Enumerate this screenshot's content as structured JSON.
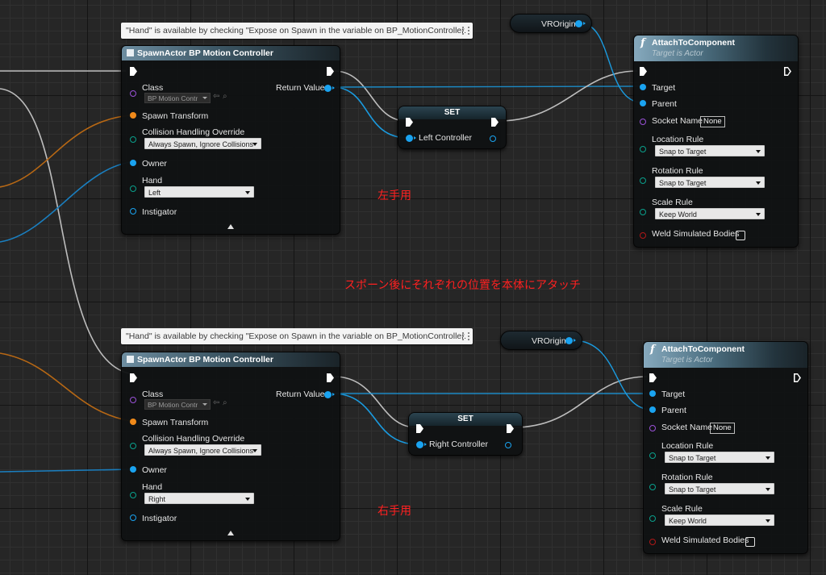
{
  "comments": {
    "left": "左手用",
    "middle": "スポーン後にそれぞれの位置を本体にアタッチ",
    "right": "右手用"
  },
  "left": {
    "tooltip": "\"Hand\" is available by checking \"Expose on Spawn in the variable on BP_MotionController.",
    "spawn": {
      "title": "SpawnActor BP Motion Controller",
      "class_label": "Class",
      "class_value": "BP Motion Contr",
      "return_label": "Return Value",
      "spawn_transform": "Spawn Transform",
      "collision_label": "Collision Handling Override",
      "collision_value": "Always Spawn, Ignore Collisions",
      "owner": "Owner",
      "hand_label": "Hand",
      "hand_value": "Left",
      "instigator": "Instigator"
    },
    "vr_origin": "VROrigin",
    "set": {
      "title": "SET",
      "pin_label": "Left Controller"
    },
    "attach": {
      "title": "AttachToComponent",
      "subtitle": "Target is Actor",
      "target": "Target",
      "parent": "Parent",
      "socket_label": "Socket Name",
      "socket_value": "None",
      "location_label": "Location Rule",
      "location_value": "Snap to Target",
      "rotation_label": "Rotation Rule",
      "rotation_value": "Snap to Target",
      "scale_label": "Scale Rule",
      "scale_value": "Keep World",
      "weld_label": "Weld Simulated Bodies"
    }
  },
  "right": {
    "tooltip": "\"Hand\" is available by checking \"Expose on Spawn in the variable on BP_MotionController.",
    "spawn": {
      "title": "SpawnActor BP Motion Controller",
      "class_label": "Class",
      "class_value": "BP Motion Contr",
      "return_label": "Return Value",
      "spawn_transform": "Spawn Transform",
      "collision_label": "Collision Handling Override",
      "collision_value": "Always Spawn, Ignore Collisions",
      "owner": "Owner",
      "hand_label": "Hand",
      "hand_value": "Right",
      "instigator": "Instigator"
    },
    "vr_origin": "VROrigin",
    "set": {
      "title": "SET",
      "pin_label": "Right Controller"
    },
    "attach": {
      "title": "AttachToComponent",
      "subtitle": "Target is Actor",
      "target": "Target",
      "parent": "Parent",
      "socket_label": "Socket Name",
      "socket_value": "None",
      "location_label": "Location Rule",
      "location_value": "Snap to Target",
      "rotation_label": "Rotation Rule",
      "rotation_value": "Snap to Target",
      "scale_label": "Scale Rule",
      "scale_value": "Keep World",
      "weld_label": "Weld Simulated Bodies"
    }
  },
  "colors": {
    "exec_wire": "#c8c8c8",
    "object_wire": "#1aa3f0",
    "transform_wire": "#f08a1a",
    "comment_text": "#ff2020"
  }
}
